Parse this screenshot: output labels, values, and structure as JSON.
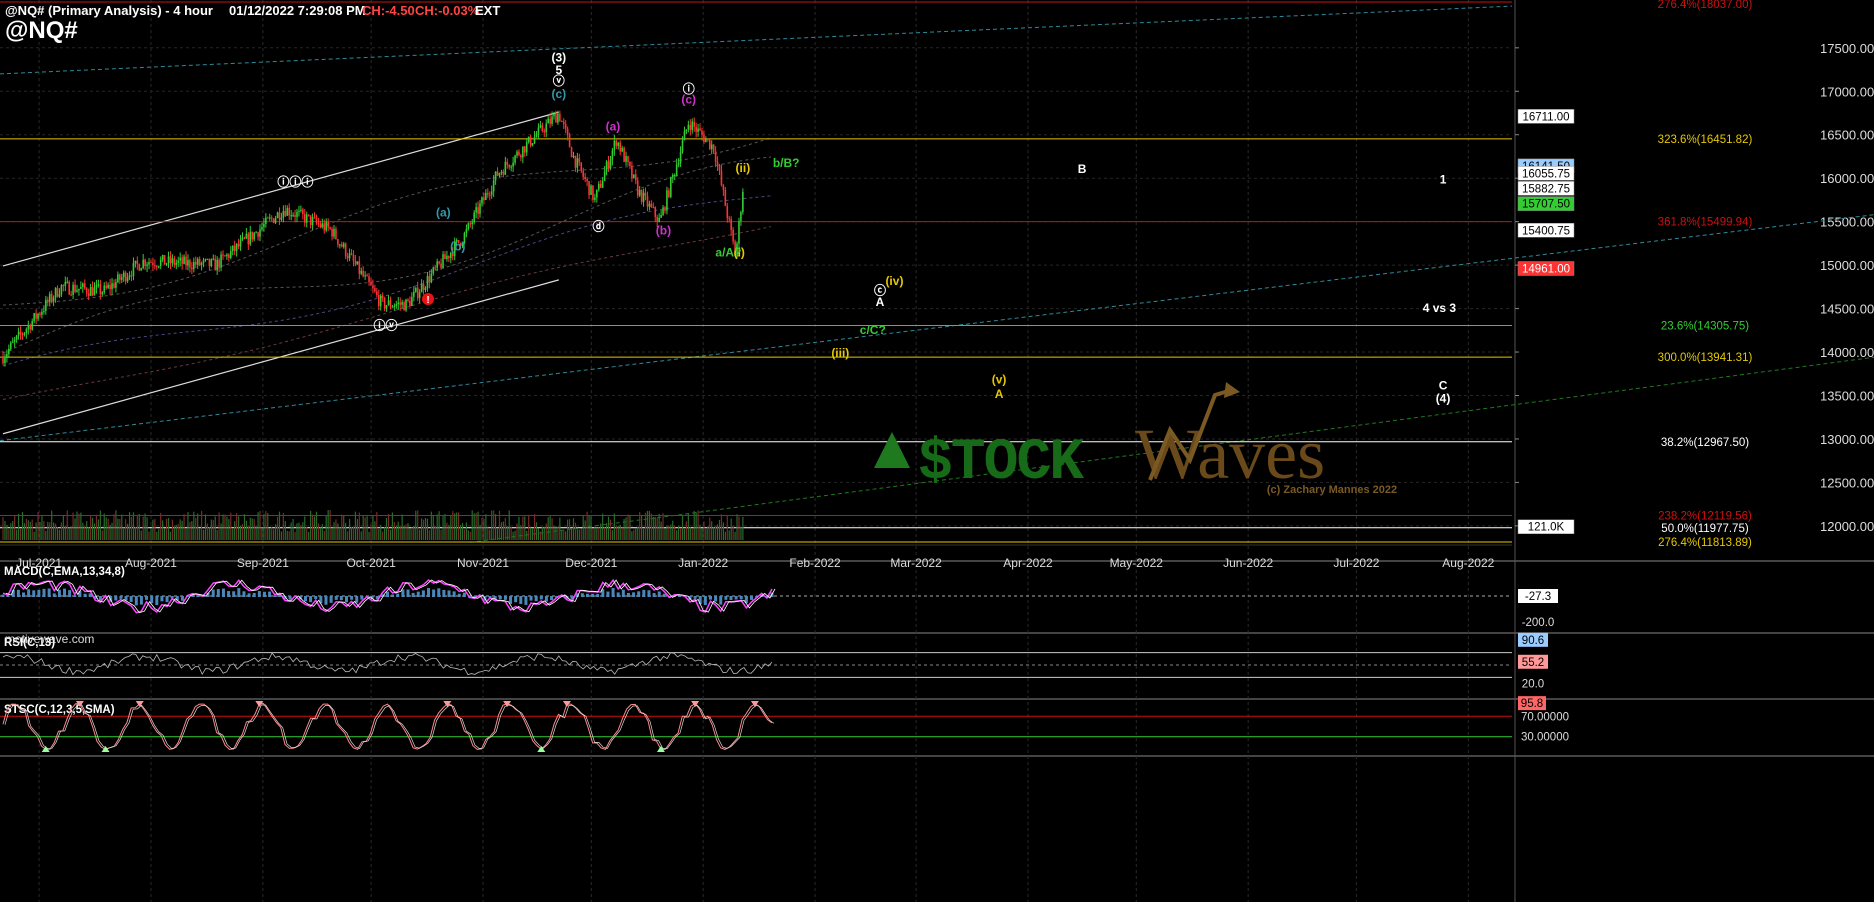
{
  "header": {
    "instrument": "@NQ# (Primary Analysis) - 4 hour",
    "datetime": "01/12/2022 7:29:08 PM",
    "change_pts": "CH:-4.50",
    "change_pct": "CH:-0.03%",
    "session": "EXT",
    "symbol": "@NQ#"
  },
  "watermark": "motivewave.com",
  "logo": {
    "text": "$TOCKWaves",
    "credit": "(c) Zachary Mannes 2022"
  },
  "colors": {
    "background": "#000000",
    "up_candle": "#33cc33",
    "down_candle": "#ff3333",
    "fib_yellow": "#e6c800",
    "fib_red": "#cc1111",
    "channel": "#dddddd",
    "macd": "#ff44ff",
    "histogram": "#5599cc"
  },
  "chart_data": [
    {
      "type": "candlestick",
      "title": "@NQ# (Primary Analysis) - 4 hour",
      "x_axis_labels": [
        "Jul-2021",
        "Aug-2021",
        "Sep-2021",
        "Oct-2021",
        "Nov-2021",
        "Dec-2021",
        "Jan-2022",
        "Feb-2022",
        "Mar-2022",
        "Apr-2022",
        "May-2022",
        "Jun-2022",
        "Jul-2022",
        "Aug-2022"
      ],
      "y_ticks": [
        "17500.00",
        "17000.00",
        "16500.00",
        "16000.00",
        "15500.00",
        "15000.00",
        "14500.00",
        "14000.00",
        "13500.00",
        "13000.00",
        "12500.00",
        "12000.00"
      ],
      "ylim": [
        11780,
        18050
      ],
      "price_path": {
        "dates": [
          "2021-06-21",
          "2021-07-07",
          "2021-07-19",
          "2021-07-30",
          "2021-08-19",
          "2021-09-07",
          "2021-09-20",
          "2021-10-04",
          "2021-10-11",
          "2021-10-27",
          "2021-11-05",
          "2021-11-22",
          "2021-11-26",
          "2021-12-02",
          "2021-12-08",
          "2021-12-14",
          "2021-12-20",
          "2021-12-28",
          "2022-01-04",
          "2022-01-10",
          "2022-01-12"
        ],
        "values": [
          13950,
          14750,
          14700,
          15050,
          15000,
          15650,
          15400,
          14550,
          14550,
          15350,
          16050,
          16750,
          16250,
          15750,
          16450,
          15850,
          15500,
          16650,
          16350,
          15100,
          15880
        ]
      },
      "price_labels": [
        {
          "text": "16711.00",
          "value": 16711,
          "bg": "#ffffff",
          "fg": "#000000"
        },
        {
          "text": "16141.50",
          "value": 16141.5,
          "bg": "#99ccff",
          "fg": "#000000"
        },
        {
          "text": "16055.75",
          "value": 16055.75,
          "bg": "#ffffff",
          "fg": "#000000"
        },
        {
          "text": "15882.75",
          "value": 15882.75,
          "bg": "#ffffff",
          "fg": "#000000"
        },
        {
          "text": "15707.50",
          "value": 15707.5,
          "bg": "#33cc33",
          "fg": "#000000"
        },
        {
          "text": "15400.75",
          "value": 15400.75,
          "bg": "#ffffff",
          "fg": "#000000"
        },
        {
          "text": "14961.00",
          "value": 14961,
          "bg": "#ff3333",
          "fg": "#ffffff"
        },
        {
          "text": "121.0K",
          "value": 11990,
          "bg": "#ffffff",
          "fg": "#000000"
        }
      ],
      "fib_levels": [
        {
          "text": "276.4%(18037.00)",
          "value": 18037,
          "color": "#cc1111"
        },
        {
          "text": "323.6%(16451.82)",
          "value": 16451.82,
          "color": "#e6c800"
        },
        {
          "text": "361.8%(15499.94)",
          "value": 15499.94,
          "color": "#cc1111"
        },
        {
          "text": "23.6%(14305.75)",
          "value": 14305.75,
          "color": "#33cc33"
        },
        {
          "text": "300.0%(13941.31)",
          "value": 13941.31,
          "color": "#e6c800"
        },
        {
          "text": "38.2%(12967.50)",
          "value": 12967.5,
          "color": "#ffffff"
        },
        {
          "text": "238.2%(12119.56)",
          "value": 12119.56,
          "color": "#cc1111"
        },
        {
          "text": "50.0%(11977.75)",
          "value": 11977.75,
          "color": "#ffffff"
        },
        {
          "text": "276.4%(11813.89)",
          "value": 11813.89,
          "color": "#e6c800"
        }
      ],
      "wave_labels": [
        {
          "text": "(3)",
          "date": "2021-11-22",
          "value": 17340,
          "color": "#ffffff"
        },
        {
          "text": "5",
          "date": "2021-11-22",
          "value": 17200,
          "color": "#ffffff"
        },
        {
          "text": "ⓥ",
          "date": "2021-11-22",
          "value": 17070,
          "color": "#ffffff"
        },
        {
          "text": "(c)",
          "date": "2021-11-22",
          "value": 16920,
          "color": "#3399aa"
        },
        {
          "text": "ⓘ",
          "date": "2021-12-28",
          "value": 16980,
          "color": "#ffffff"
        },
        {
          "text": "(c)",
          "date": "2021-12-28",
          "value": 16860,
          "color": "#cc33cc"
        },
        {
          "text": "(a)",
          "date": "2021-12-07",
          "value": 16550,
          "color": "#cc33cc"
        },
        {
          "text": "(b)",
          "date": "2021-12-21",
          "value": 15350,
          "color": "#cc33cc"
        },
        {
          "text": "ⓓ",
          "date": "2021-12-03",
          "value": 15400,
          "color": "#ffffff"
        },
        {
          "text": "ⓘⓘⓘ",
          "date": "2021-09-10",
          "value": 15910,
          "color": "#ffffff"
        },
        {
          "text": "ⓘⓥ",
          "date": "2021-10-05",
          "value": 14260,
          "color": "#ffffff"
        },
        {
          "text": "(a)",
          "date": "2021-10-21",
          "value": 15560,
          "color": "#3399aa"
        },
        {
          "text": "(b)",
          "date": "2021-10-25",
          "value": 15170,
          "color": "#3399aa"
        },
        {
          "text": "(ii)",
          "date": "2022-01-12",
          "value": 16070,
          "color": "#e6c800"
        },
        {
          "text": "b/B?",
          "date": "2022-01-24",
          "value": 16130,
          "color": "#33cc33"
        },
        {
          "text": "(i)",
          "date": "2022-01-11",
          "value": 15100,
          "color": "#e6c800"
        },
        {
          "text": "a/A?",
          "date": "2022-01-08",
          "value": 15100,
          "color": "#33cc33"
        },
        {
          "text": "B",
          "date": "2022-04-16",
          "value": 16060,
          "color": "#ffffff"
        },
        {
          "text": "1",
          "date": "2022-07-25",
          "value": 15940,
          "color": "#ffffff"
        },
        {
          "text": "(iv)",
          "date": "2022-02-23",
          "value": 14770,
          "color": "#e6c800"
        },
        {
          "text": "ⓒ",
          "date": "2022-02-19",
          "value": 14660,
          "color": "#ffffff"
        },
        {
          "text": "A",
          "date": "2022-02-19",
          "value": 14530,
          "color": "#ffffff"
        },
        {
          "text": "c/C?",
          "date": "2022-02-17",
          "value": 14210,
          "color": "#33cc33"
        },
        {
          "text": "(iii)",
          "date": "2022-02-08",
          "value": 13940,
          "color": "#e6c800"
        },
        {
          "text": "4 vs 3",
          "date": "2022-07-24",
          "value": 14460,
          "color": "#ffffff"
        },
        {
          "text": "(v)",
          "date": "2022-03-24",
          "value": 13640,
          "color": "#e6c800"
        },
        {
          "text": "A",
          "date": "2022-03-24",
          "value": 13470,
          "color": "#e6c800"
        },
        {
          "text": "C",
          "date": "2022-07-25",
          "value": 13570,
          "color": "#ffffff"
        },
        {
          "text": "(4)",
          "date": "2022-07-25",
          "value": 13420,
          "color": "#ffffff"
        }
      ]
    },
    {
      "type": "line",
      "title": "MACD(C,EMA,13,34,8)",
      "y_labels": [
        {
          "text": "-27.3",
          "value": -27.3,
          "bg": "#ffffff",
          "fg": "#000000"
        },
        {
          "text": "-200.0",
          "value": -200,
          "bg": "",
          "fg": "#dddddd"
        }
      ]
    },
    {
      "type": "line",
      "title": "RSI(C,13)",
      "y_labels": [
        {
          "text": "90.6",
          "value": 90.6,
          "bg": "#99ccff",
          "fg": "#000000"
        },
        {
          "text": "55.2",
          "value": 55.2,
          "bg": "#ff9999",
          "fg": "#000000"
        },
        {
          "text": "20.0",
          "value": 20,
          "bg": "",
          "fg": "#dddddd"
        }
      ]
    },
    {
      "type": "line",
      "title": "STSC(C,12,3,5,SMA)",
      "y_labels": [
        {
          "text": "95.8",
          "value": 95.8,
          "bg": "#ff6666",
          "fg": "#000000"
        },
        {
          "text": "70.00000",
          "value": 70,
          "bg": "",
          "fg": "#dddddd"
        },
        {
          "text": "30.00000",
          "value": 30,
          "bg": "",
          "fg": "#dddddd"
        }
      ]
    }
  ]
}
